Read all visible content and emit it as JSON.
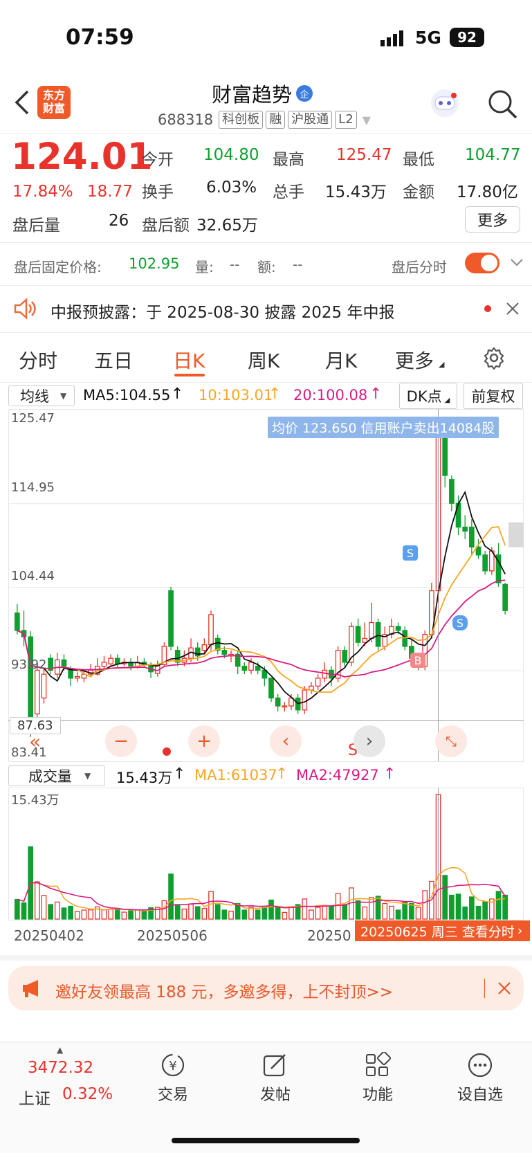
{
  "status_bar": {
    "time": "07:59",
    "network": "5G",
    "battery": "92"
  },
  "header": {
    "app_logo_line1": "东方",
    "app_logo_line2": "财富",
    "stock_name": "财富趋势",
    "verified_badge": "企",
    "stock_code": "688318",
    "tags": [
      "科创板",
      "融",
      "沪股通",
      "L2"
    ]
  },
  "quote": {
    "price": "124.01",
    "change_pct": "17.84%",
    "change_amt": "18.77",
    "open_label": "今开",
    "open": "104.80",
    "high_label": "最高",
    "high": "125.47",
    "low_label": "最低",
    "low": "104.77",
    "turnover_label": "换手",
    "turnover": "6.03%",
    "volume_label": "总手",
    "volume": "15.43万",
    "amount_label": "金额",
    "amount": "17.80亿",
    "after_vol_label": "盘后量",
    "after_vol": "26",
    "after_amt_label": "盘后额",
    "after_amt": "32.65万",
    "more_button": "更多"
  },
  "after_hours": {
    "fixed_price_label": "盘后固定价格:",
    "fixed_price": "102.95",
    "vol_label": "量:",
    "vol": "--",
    "amt_label": "额:",
    "amt": "--",
    "toggle_label": "盘后分时",
    "toggle_on": true
  },
  "notice": {
    "text": "中报预披露：于 2025-08-30 披露 2025 年中报"
  },
  "chart_tabs": {
    "items": [
      "分时",
      "五日",
      "日K",
      "周K",
      "月K",
      "更多"
    ],
    "active": "日K"
  },
  "indicator_bar": {
    "selector": "均线",
    "ma5": "MA5:104.55",
    "ma10": "10:103.01",
    "ma20": "20:100.08",
    "dk_button": "DK点",
    "adjust_button": "前复权"
  },
  "price_axis": {
    "labels": [
      "125.47",
      "114.95",
      "104.44",
      "93.92",
      "83.41"
    ],
    "marker": "87.63"
  },
  "tooltip": {
    "text": "均价 123.650 信用账户卖出14084股"
  },
  "chart_markers": {
    "sell": "S",
    "buy": "B"
  },
  "volume_bar": {
    "selector": "成交量",
    "current": "15.43万",
    "ma1": "MA1:61037",
    "ma2": "MA2:47927",
    "max_label": "15.43万"
  },
  "date_axis": {
    "labels": [
      "20250402",
      "20250506",
      "20250"
    ],
    "callout": "20250625 周三 查看分时"
  },
  "promo": {
    "text": "邀好友领最高 188 元，多邀多得，上不封顶>>"
  },
  "bottom_nav": {
    "index_value": "3472.32",
    "index_name": "上证",
    "index_change": "0.32%",
    "items": [
      {
        "label": "交易",
        "icon": "yuan-exchange-icon"
      },
      {
        "label": "发帖",
        "icon": "edit-icon"
      },
      {
        "label": "功能",
        "icon": "grid-icon"
      },
      {
        "label": "设自选",
        "icon": "more-dots-icon"
      }
    ]
  },
  "chart_data": {
    "type": "candlestick",
    "y_axis_price_range": [
      83.41,
      125.47
    ],
    "candles": [
      [
        101.2,
        99.0,
        102.3,
        98.5
      ],
      [
        99.0,
        98.2,
        101.5,
        97.0
      ],
      [
        98.2,
        86.5,
        98.9,
        85.6
      ],
      [
        88.5,
        94.0,
        94.8,
        88.0
      ],
      [
        90.5,
        93.5,
        94.2,
        89.8
      ],
      [
        95.5,
        94.0,
        96.0,
        93.5
      ],
      [
        93.5,
        95.3,
        96.2,
        93.0
      ],
      [
        95.3,
        94.5,
        96.0,
        94.0
      ],
      [
        94.0,
        93.0,
        94.5,
        92.0
      ],
      [
        93.0,
        93.2,
        93.8,
        92.5
      ],
      [
        93.0,
        93.5,
        94.0,
        92.5
      ],
      [
        93.5,
        94.0,
        94.8,
        93.2
      ],
      [
        93.5,
        94.5,
        95.5,
        93.3
      ],
      [
        94.5,
        95.0,
        95.8,
        94.2
      ],
      [
        94.8,
        95.5,
        96.0,
        94.5
      ],
      [
        95.5,
        94.8,
        96.0,
        94.3
      ],
      [
        94.8,
        95.0,
        95.5,
        94.5
      ],
      [
        95.0,
        94.5,
        95.5,
        94.0
      ],
      [
        94.5,
        95.0,
        95.8,
        94.2
      ],
      [
        95.0,
        94.7,
        95.5,
        94.3
      ],
      [
        94.7,
        93.8,
        95.0,
        93.0
      ],
      [
        93.6,
        94.6,
        95.2,
        93.2
      ],
      [
        94.7,
        97.0,
        97.5,
        94.5
      ],
      [
        104.0,
        97.0,
        104.5,
        96.5
      ],
      [
        96.5,
        95.0,
        97.0,
        94.5
      ],
      [
        95.0,
        95.5,
        96.5,
        94.5
      ],
      [
        95.5,
        96.8,
        98.0,
        95.0
      ],
      [
        96.8,
        95.8,
        97.5,
        95.2
      ],
      [
        96.5,
        97.2,
        98.0,
        96.0
      ],
      [
        97.2,
        101.0,
        101.5,
        96.5
      ],
      [
        98.0,
        96.5,
        98.5,
        96.0
      ],
      [
        96.5,
        96.0,
        97.0,
        95.5
      ],
      [
        95.8,
        96.0,
        96.5,
        95.0
      ],
      [
        96.0,
        94.5,
        96.5,
        93.5
      ],
      [
        94.5,
        94.0,
        95.0,
        93.5
      ],
      [
        94.0,
        95.0,
        95.5,
        93.5
      ],
      [
        94.5,
        94.0,
        95.0,
        93.5
      ],
      [
        94.0,
        93.0,
        94.5,
        92.0
      ],
      [
        93.0,
        90.5,
        93.0,
        90.0
      ],
      [
        90.5,
        89.5,
        91.0,
        88.8
      ],
      [
        89.5,
        89.5,
        90.0,
        88.8
      ],
      [
        89.5,
        90.5,
        91.0,
        89.0
      ],
      [
        90.5,
        89.0,
        91.0,
        88.5
      ],
      [
        89.0,
        91.5,
        92.0,
        88.5
      ],
      [
        91.5,
        92.0,
        92.5,
        91.0
      ],
      [
        92.0,
        93.0,
        93.5,
        91.5
      ],
      [
        93.0,
        94.0,
        95.0,
        92.5
      ],
      [
        94.0,
        93.0,
        94.5,
        92.0
      ],
      [
        93.0,
        96.5,
        97.0,
        92.5
      ],
      [
        96.5,
        95.0,
        97.0,
        94.5
      ],
      [
        95.0,
        99.5,
        100.0,
        94.5
      ],
      [
        99.5,
        97.5,
        100.5,
        97.0
      ],
      [
        97.5,
        98.0,
        100.0,
        97.0
      ],
      [
        98.0,
        100.0,
        102.5,
        97.5
      ],
      [
        100.0,
        97.0,
        100.5,
        96.5
      ],
      [
        97.0,
        98.5,
        99.5,
        96.5
      ],
      [
        98.5,
        99.5,
        100.5,
        98.0
      ],
      [
        99.5,
        99.0,
        100.0,
        98.5
      ],
      [
        99.0,
        97.0,
        99.5,
        96.5
      ],
      [
        97.0,
        95.5,
        98.0,
        95.0
      ],
      [
        94.5,
        95.5,
        96.0,
        94.0
      ],
      [
        94.5,
        98.5,
        99.0,
        94.0
      ],
      [
        98.5,
        104.0,
        105.0,
        98.0
      ],
      [
        104.0,
        125.0,
        125.47,
        102.5
      ],
      [
        125.0,
        118.5,
        125.2,
        117.0
      ],
      [
        118.0,
        115.0,
        118.5,
        114.0
      ],
      [
        115.0,
        112.0,
        116.0,
        111.0
      ],
      [
        112.0,
        111.5,
        113.5,
        110.5
      ],
      [
        112.0,
        109.5,
        113.0,
        108.5
      ],
      [
        109.5,
        108.5,
        110.5,
        108.0
      ],
      [
        108.5,
        106.5,
        109.0,
        106.0
      ],
      [
        106.5,
        109.0,
        109.5,
        106.0
      ],
      [
        108.5,
        105.0,
        110.0,
        104.5
      ],
      [
        104.8,
        101.5,
        105.0,
        101.0
      ]
    ],
    "volume_max": "15.43万",
    "ma5_last": "104.55",
    "ma10_last": "103.01",
    "ma20_last": "100.08",
    "colors": {
      "up": "#e8322b",
      "down": "#0f9f2f",
      "ma5": "#111111",
      "ma10": "#f5a623",
      "ma20": "#d81b86"
    }
  }
}
